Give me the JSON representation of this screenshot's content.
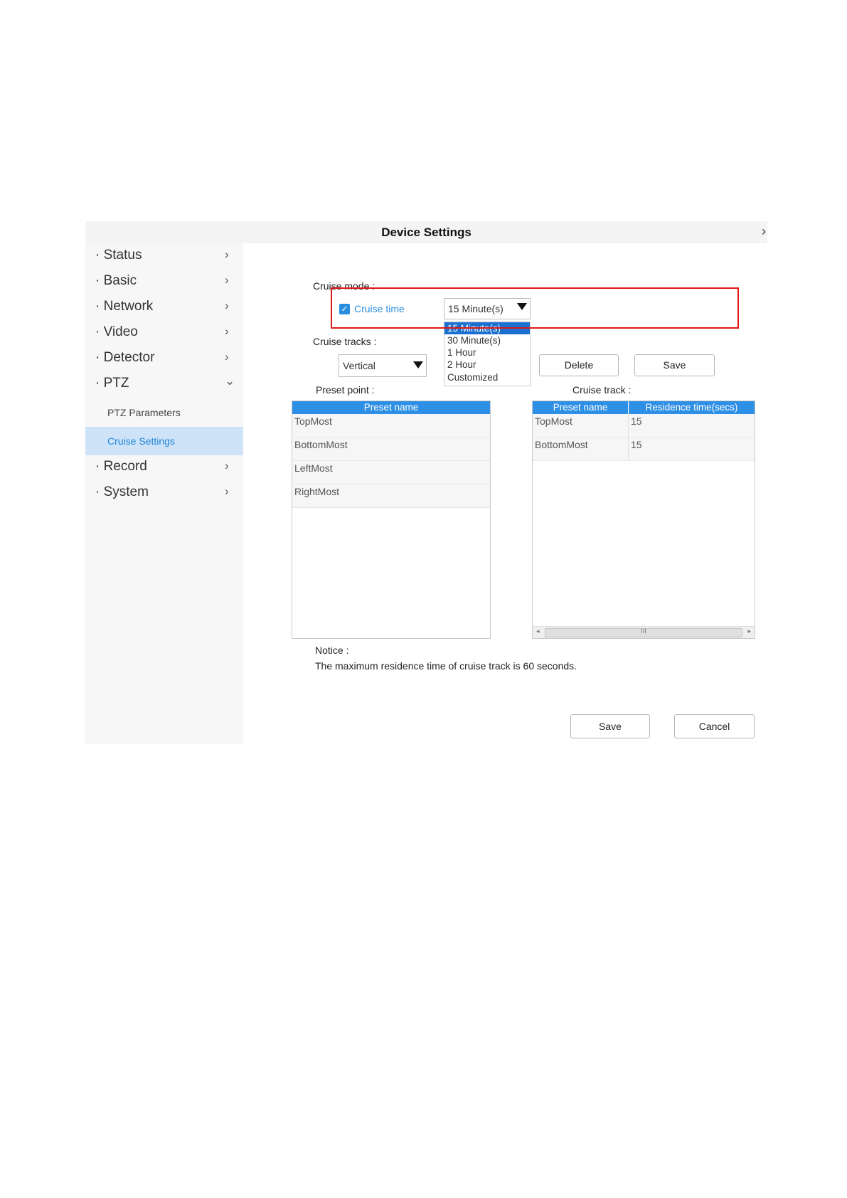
{
  "title": "Device Settings",
  "sidebar": {
    "items": [
      {
        "label": "· Status"
      },
      {
        "label": "· Basic"
      },
      {
        "label": "· Network"
      },
      {
        "label": "· Video"
      },
      {
        "label": "· Detector"
      },
      {
        "label": "· PTZ"
      },
      {
        "label": "· Record"
      },
      {
        "label": "· System"
      }
    ],
    "ptz_sub": [
      {
        "label": "PTZ Parameters"
      },
      {
        "label": "Cruise Settings"
      }
    ]
  },
  "cruise_mode": {
    "label": "Cruise mode :",
    "checkbox_label": "Cruise time",
    "checked": true,
    "selected": "15 Minute(s)",
    "options": [
      "15 Minute(s)",
      "30 Minute(s)",
      "1 Hour",
      "2 Hour",
      "Customized"
    ]
  },
  "cruise_tracks": {
    "label": "Cruise tracks :",
    "selected": "Vertical",
    "delete_label": "Delete",
    "save_label": "Save"
  },
  "preset_table": {
    "label": "Preset point :",
    "header": "Preset name",
    "rows": [
      "TopMost",
      "BottomMost",
      "LeftMost",
      "RightMost"
    ]
  },
  "track_table": {
    "label": "Cruise track :",
    "headers": [
      "Preset name",
      "Residence time(secs)"
    ],
    "rows": [
      {
        "name": "TopMost",
        "time": "15"
      },
      {
        "name": "BottomMost",
        "time": "15"
      }
    ],
    "scroll_grip": "III"
  },
  "notice": {
    "label": "Notice :",
    "text": "The maximum residence time of cruise track is 60 seconds."
  },
  "footer": {
    "save_label": "Save",
    "cancel_label": "Cancel"
  },
  "colors": {
    "accent": "#2e8fe6",
    "highlight_box": "#e01818",
    "active_bg": "#cfe3f8"
  }
}
